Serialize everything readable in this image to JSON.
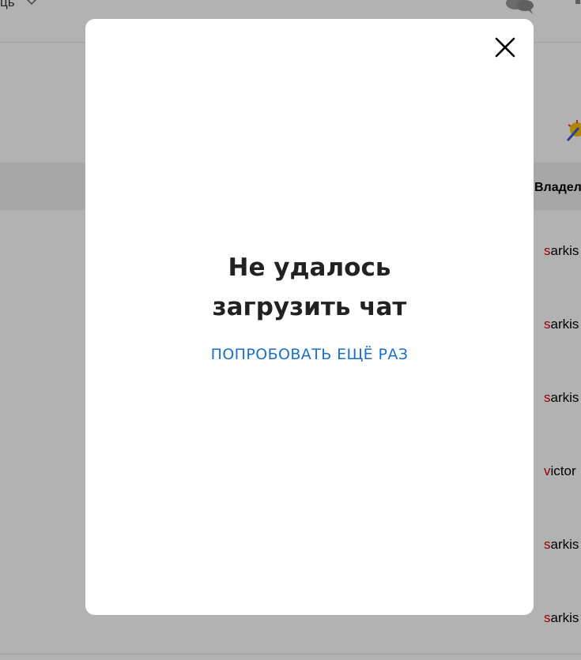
{
  "background": {
    "header": {
      "help_label": "ць",
      "chevron_icon": "chevron-down-icon",
      "chat_icon": "chat-bubbles-icon"
    },
    "table": {
      "owner_header": "Владел",
      "rows": [
        {
          "owner_first": "s",
          "owner_rest": "arkis"
        },
        {
          "owner_first": "s",
          "owner_rest": "arkis"
        },
        {
          "owner_first": "s",
          "owner_rest": "arkis"
        },
        {
          "owner_first": "v",
          "owner_rest": "ictor"
        },
        {
          "owner_first": "s",
          "owner_rest": "arkis"
        },
        {
          "owner_first": "s",
          "owner_rest": "arkis"
        }
      ]
    }
  },
  "modal": {
    "close_icon": "close-icon",
    "title_line1": "Не удалось",
    "title_line2": "загрузить чат",
    "retry_label": "ПОПРОБОВАТЬ ЕЩЁ РАЗ"
  },
  "colors": {
    "accent": "#1a6fc8",
    "owner_initial": "#e00000",
    "title": "#222222",
    "overlay": "rgba(0,0,0,0.3)"
  }
}
